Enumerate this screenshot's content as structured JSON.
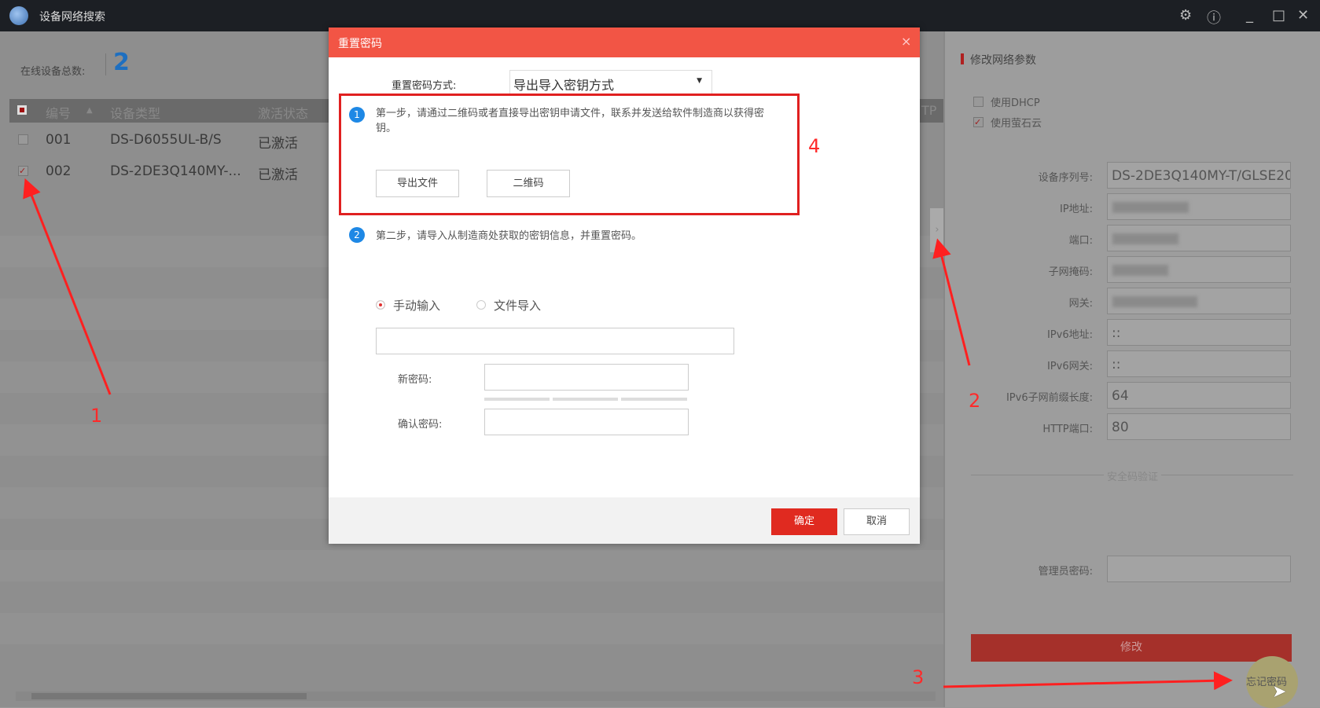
{
  "app": {
    "title": "设备网络搜索",
    "icons": [
      "settings-icon",
      "info-icon",
      "minimize-icon",
      "maximize-icon",
      "close-icon"
    ]
  },
  "list": {
    "online_label": "在线设备总数:",
    "online_count": "2",
    "columns": [
      "编号",
      "设备类型",
      "激活状态",
      "TP"
    ],
    "rows": [
      {
        "id": "001",
        "type": "DS-D6055UL-B/S",
        "status": "已激活",
        "checked": false
      },
      {
        "id": "002",
        "type": "DS-2DE3Q140MY-...",
        "status": "已激活",
        "checked": true
      }
    ]
  },
  "right": {
    "title": "修改网络参数",
    "dhcp": "使用DHCP",
    "ezviz": "使用萤石云",
    "fields": [
      {
        "label": "设备序列号:",
        "value": "DS-2DE3Q140MY-T/GLSE20"
      },
      {
        "label": "IP地址:",
        "value": ""
      },
      {
        "label": "端口:",
        "value": ""
      },
      {
        "label": "子网掩码:",
        "value": ""
      },
      {
        "label": "网关:",
        "value": ""
      },
      {
        "label": "IPv6地址:",
        "value": "::"
      },
      {
        "label": "IPv6网关:",
        "value": "::"
      },
      {
        "label": "IPv6子网前缀长度:",
        "value": "64"
      },
      {
        "label": "HTTP端口:",
        "value": "80"
      }
    ],
    "security": "安全码验证",
    "admin_pwd": "管理员密码:",
    "modify": "修改",
    "forgot": "忘记密码"
  },
  "dialog": {
    "title": "重置密码",
    "close": "×",
    "method_label": "重置密码方式:",
    "method_value": "导出导入密钥方式",
    "step1_no": "1",
    "step1": "第一步，请通过二维码或者直接导出密钥申请文件，联系并发送给软件制造商以获得密钥。",
    "export_btn": "导出文件",
    "qr_btn": "二维码",
    "step2_no": "2",
    "step2": "第二步，请导入从制造商处获取的密钥信息，并重置密码。",
    "manual": "手动输入",
    "file_import": "文件导入",
    "new_pwd": "新密码:",
    "confirm_pwd": "确认密码:",
    "ok": "确定",
    "cancel": "取消"
  },
  "annotations": [
    "1",
    "2",
    "3",
    "4"
  ]
}
